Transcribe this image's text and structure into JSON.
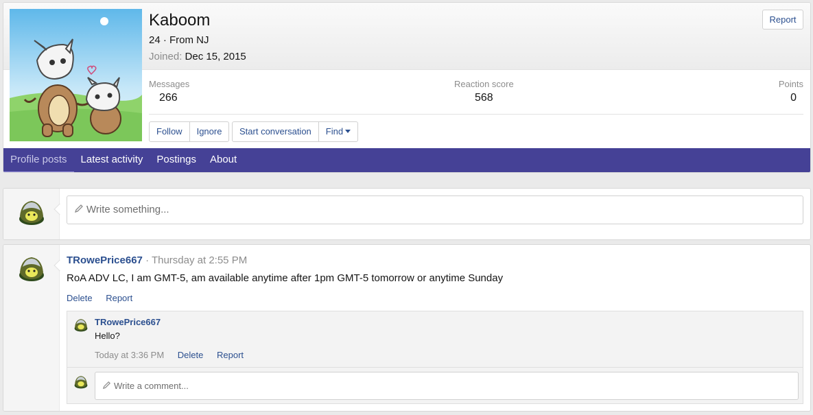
{
  "profile": {
    "username": "Kaboom",
    "age_location": "24 · From NJ",
    "joined_label": "Joined:",
    "joined_date": "Dec 15, 2015",
    "report_label": "Report",
    "avatar_icon": "cubone-marowak-avatar",
    "stats": {
      "messages_label": "Messages",
      "messages_value": "266",
      "reaction_label": "Reaction score",
      "reaction_value": "568",
      "points_label": "Points",
      "points_value": "0"
    },
    "buttons": {
      "follow": "Follow",
      "ignore": "Ignore",
      "start_conversation": "Start conversation",
      "find": "Find"
    }
  },
  "tabs": [
    {
      "label": "Profile posts",
      "active": true
    },
    {
      "label": "Latest activity",
      "active": false
    },
    {
      "label": "Postings",
      "active": false
    },
    {
      "label": "About",
      "active": false
    }
  ],
  "write_box": {
    "placeholder": "Write something..."
  },
  "post": {
    "author": "TRowePrice667",
    "meta": "· Thursday at 2:55 PM",
    "body": "RoA ADV LC, I am GMT-5, am available anytime after 1pm GMT-5 tomorrow or anytime Sunday",
    "delete_label": "Delete",
    "report_label": "Report",
    "comment": {
      "author": "TRowePrice667",
      "text": "Hello?",
      "time": "Today at 3:36 PM",
      "delete_label": "Delete",
      "report_label": "Report"
    },
    "comment_placeholder": "Write a comment..."
  },
  "colors": {
    "tab_bar": "#454196",
    "link": "#2b4f8f",
    "muted": "#8c8c8c"
  }
}
